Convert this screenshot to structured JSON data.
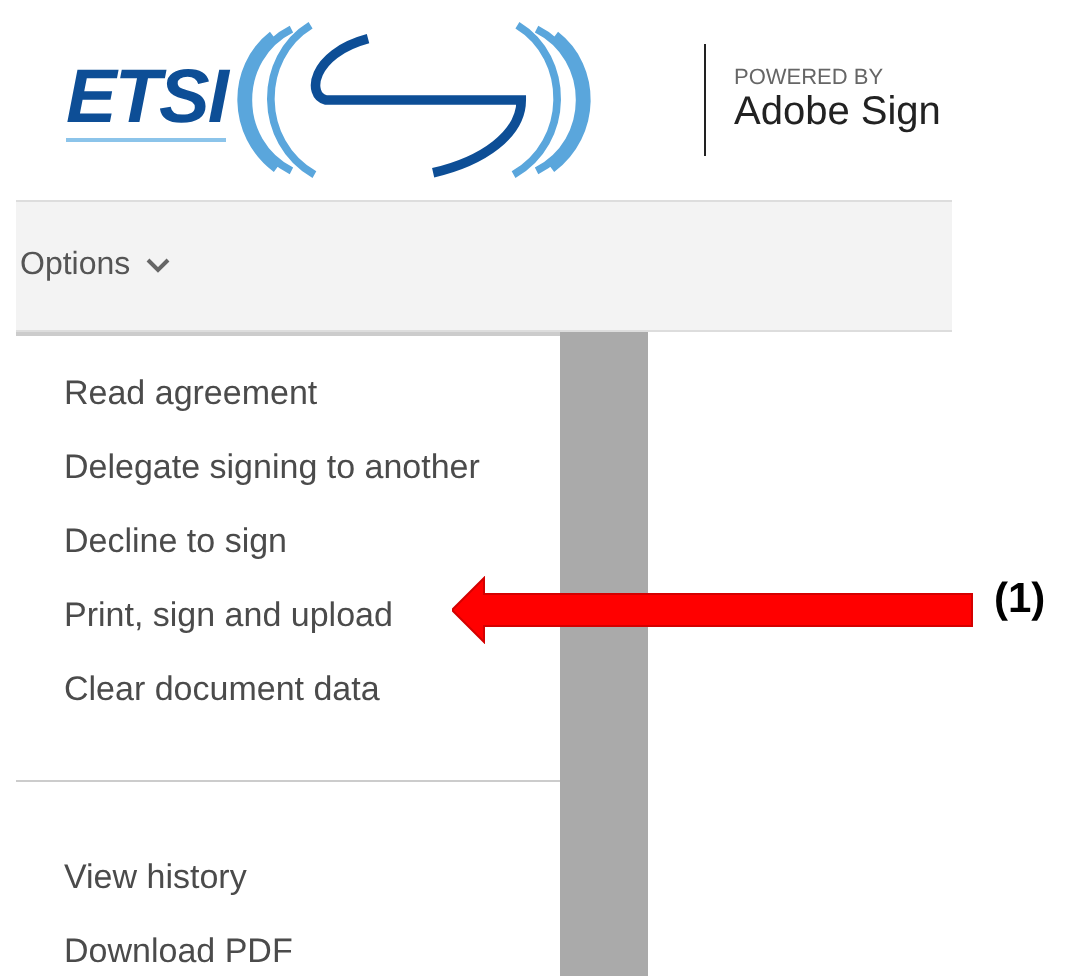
{
  "header": {
    "logo_text": "ETSI",
    "powered_by": "POWERED BY",
    "product": "Adobe Sign"
  },
  "toolbar": {
    "options_label": "Options"
  },
  "menu": {
    "groups": [
      [
        "Read agreement",
        "Delegate signing to another",
        "Decline to sign",
        "Print, sign and upload",
        "Clear document data"
      ],
      [
        "View history",
        "Download PDF"
      ]
    ]
  },
  "annotation": {
    "label": "(1)"
  }
}
